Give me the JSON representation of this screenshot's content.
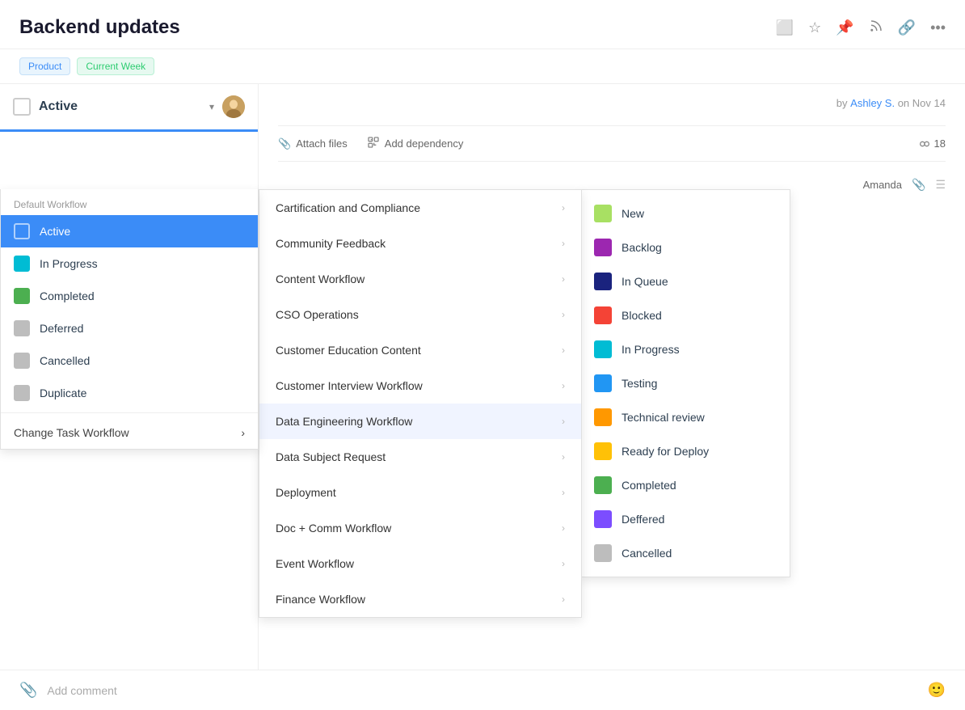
{
  "header": {
    "title": "Backend updates",
    "icons": [
      "calendar-icon",
      "star-icon",
      "pin-icon",
      "rss-icon",
      "link-icon",
      "more-icon"
    ]
  },
  "tags": [
    {
      "label": "Product",
      "style": "blue"
    },
    {
      "label": "Current Week",
      "style": "green"
    }
  ],
  "status_selector": {
    "label": "Active",
    "dropdown_arrow": "▾"
  },
  "default_workflow_label": "Default Workflow",
  "workflow_items": [
    {
      "id": "active",
      "label": "Active",
      "active": true
    },
    {
      "id": "in-progress",
      "label": "In Progress",
      "color": "cyan"
    },
    {
      "id": "completed",
      "label": "Completed",
      "color": "green"
    },
    {
      "id": "deferred",
      "label": "Deferred",
      "color": "grey"
    },
    {
      "id": "cancelled",
      "label": "Cancelled",
      "color": "grey"
    },
    {
      "id": "duplicate",
      "label": "Duplicate",
      "color": "grey"
    }
  ],
  "change_workflow_label": "Change Task Workflow",
  "workflows": [
    {
      "id": "certification",
      "label": "Cartification and Compliance"
    },
    {
      "id": "community",
      "label": "Community Feedback"
    },
    {
      "id": "content",
      "label": "Content Workflow"
    },
    {
      "id": "cso",
      "label": "CSO Operations"
    },
    {
      "id": "customer-edu",
      "label": "Customer Education Content"
    },
    {
      "id": "customer-interview",
      "label": "Customer Interview Workflow"
    },
    {
      "id": "data-eng",
      "label": "Data Engineering Workflow",
      "highlighted": true
    },
    {
      "id": "data-subject",
      "label": "Data Subject Request"
    },
    {
      "id": "deployment",
      "label": "Deployment"
    },
    {
      "id": "doc-comm",
      "label": "Doc + Comm Workflow"
    },
    {
      "id": "event",
      "label": "Event Workflow"
    },
    {
      "id": "finance",
      "label": "Finance Workflow"
    }
  ],
  "status_options": [
    {
      "id": "new",
      "label": "New",
      "dot": "lime"
    },
    {
      "id": "backlog",
      "label": "Backlog",
      "dot": "purple"
    },
    {
      "id": "in-queue",
      "label": "In Queue",
      "dot": "navy"
    },
    {
      "id": "blocked",
      "label": "Blocked",
      "dot": "red"
    },
    {
      "id": "in-progress",
      "label": "In Progress",
      "dot": "cyan"
    },
    {
      "id": "testing",
      "label": "Testing",
      "dot": "blue"
    },
    {
      "id": "technical-review",
      "label": "Technical review",
      "dot": "orange"
    },
    {
      "id": "ready-for-deploy",
      "label": "Ready for Deploy",
      "dot": "yellow"
    },
    {
      "id": "completed",
      "label": "Completed",
      "dot": "green"
    },
    {
      "id": "deffered",
      "label": "Deffered",
      "dot": "violet"
    },
    {
      "id": "cancelled",
      "label": "Cancelled",
      "dot": "grey"
    }
  ],
  "meta": {
    "author": "Ashley S.",
    "date": "Nov 14",
    "prefix": "by",
    "suffix": "on"
  },
  "actions": {
    "attach_files": "Attach files",
    "add_dependency": "Add dependency",
    "count": "18"
  },
  "comment": {
    "placeholder": "Add comment"
  },
  "assignee": "Amanda"
}
